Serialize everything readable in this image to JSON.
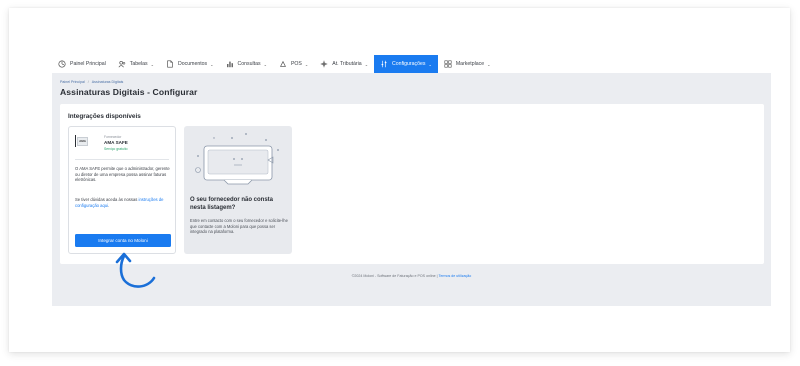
{
  "nav": {
    "items": [
      {
        "label": "Painel Principal",
        "icon": "dashboard-icon",
        "caret": false,
        "active": false
      },
      {
        "label": "Tabelas",
        "icon": "users-icon",
        "caret": true,
        "active": false
      },
      {
        "label": "Documentos",
        "icon": "document-icon",
        "caret": true,
        "active": false
      },
      {
        "label": "Consultas",
        "icon": "bar-chart-icon",
        "caret": true,
        "active": false
      },
      {
        "label": "POS",
        "icon": "pos-icon",
        "caret": true,
        "active": false
      },
      {
        "label": "At. Tributária",
        "icon": "tax-authority-icon",
        "caret": true,
        "active": false
      },
      {
        "label": "Configurações",
        "icon": "settings-sliders-icon",
        "caret": true,
        "active": true
      },
      {
        "label": "Marketplace",
        "icon": "grid-icon",
        "caret": true,
        "active": false
      }
    ],
    "caret_glyph": "⌄"
  },
  "breadcrumb": {
    "home": "Painel Principal",
    "separator": "/",
    "current": "Assinaturas Digitais"
  },
  "page": {
    "title": "Assinaturas Digitais - Configurar"
  },
  "panel": {
    "title": "Integrações disponíveis"
  },
  "provider": {
    "logo_text": "AMA",
    "label": "Fornecedor",
    "name": "AMA SAFE",
    "status": "Serviço gratuito",
    "description": "O AMA SAFE permite que o administrador, gerente ou diretor de uma empresa possa assinar faturas eletrónicas.",
    "help_prefix": "Se tiver dúvidas aceda às nossas ",
    "help_link": "instruções de configuração aqui",
    "help_suffix": ".",
    "button_label": "Integrar conta no Moloni"
  },
  "missing": {
    "title": "O seu fornecedor não consta nesta listagem?",
    "text": "Entre em contacto com o seu fornecedor e solicite-lhe que contacte com a Moloni para que possa ser integrado na plataforma."
  },
  "footer": {
    "text": "©2024 Moloni - Software de Faturação e POS online",
    "separator": "|",
    "link": "Termos de utilização"
  },
  "colors": {
    "accent": "#1a7bf0",
    "status_green": "#2aa36b",
    "content_bg": "#ebedf1",
    "annotation_arrow": "#1a6fd8"
  }
}
